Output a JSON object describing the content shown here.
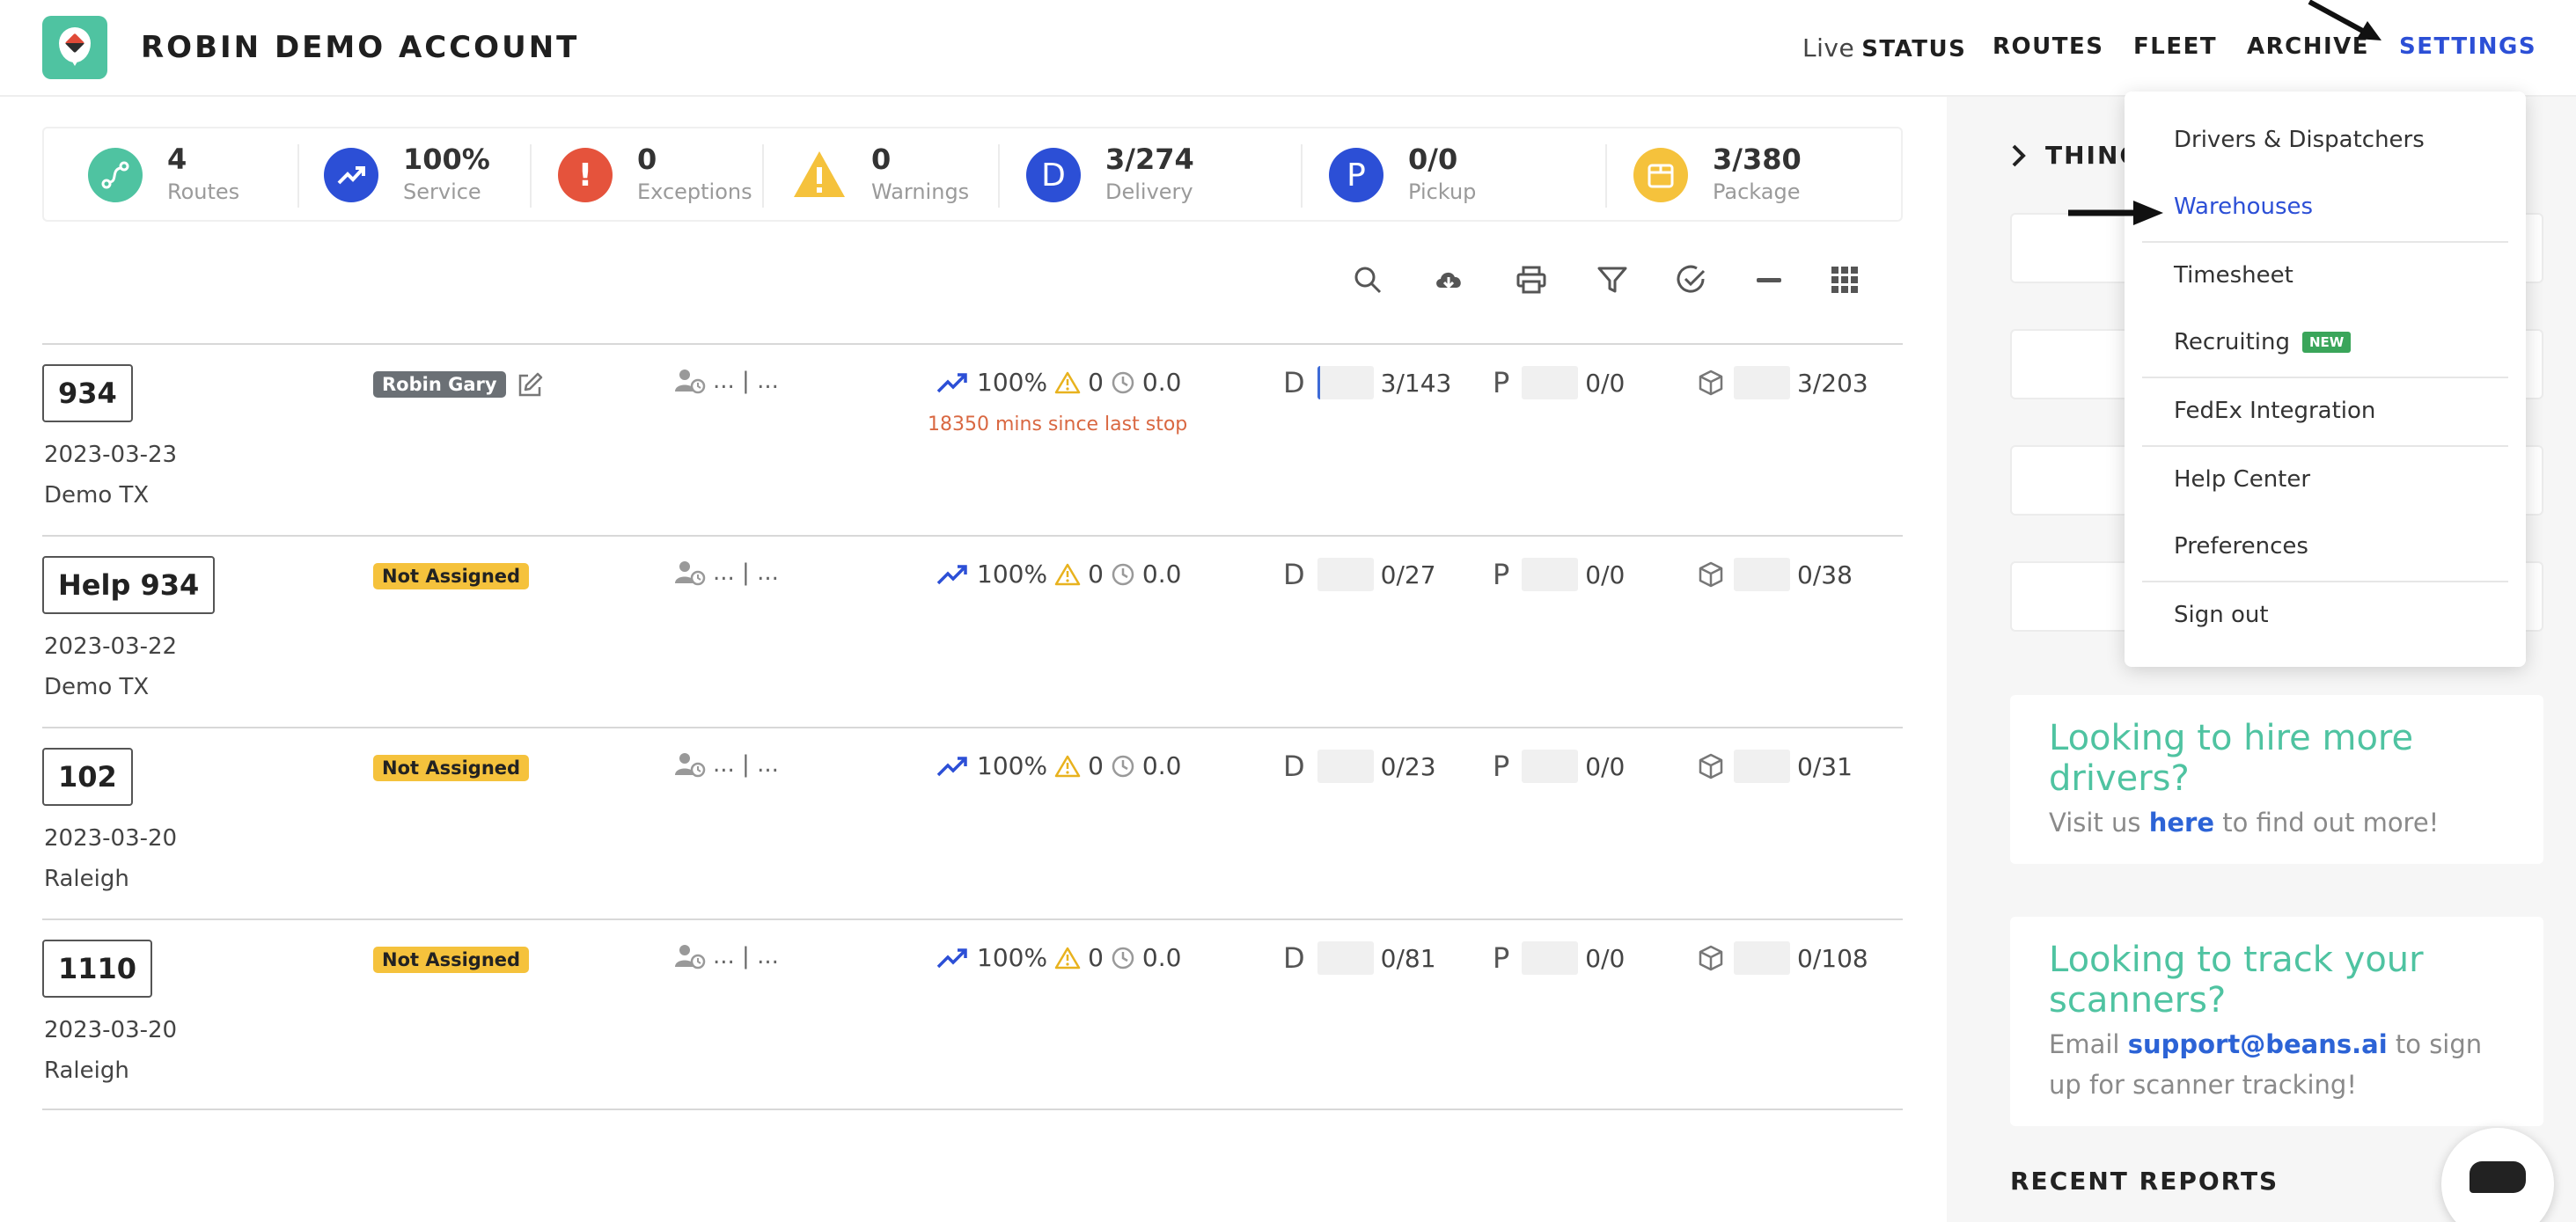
{
  "header": {
    "account_name": "ROBIN DEMO ACCOUNT",
    "nav": {
      "live_prefix": "Live",
      "live_status": "STATUS",
      "routes": "ROUTES",
      "fleet": "FLEET",
      "archive": "ARCHIVE",
      "settings": "SETTINGS"
    }
  },
  "stats": [
    {
      "value": "4",
      "label": "Routes",
      "icon": "route-icon",
      "color": "#4fc3a1"
    },
    {
      "value": "100%",
      "label": "Service",
      "icon": "trend-up-icon",
      "color": "#2c4fd6"
    },
    {
      "value": "0",
      "label": "Exceptions",
      "icon": "exclamation-circle-icon",
      "color": "#e5533c"
    },
    {
      "value": "0",
      "label": "Warnings",
      "icon": "warning-triangle-icon",
      "color": "#f5c23c"
    },
    {
      "value": "3/274",
      "label": "Delivery",
      "icon_letter": "D",
      "color": "#2c4fd6"
    },
    {
      "value": "0/0",
      "label": "Pickup",
      "icon_letter": "P",
      "color": "#2c4fd6"
    },
    {
      "value": "3/380",
      "label": "Package",
      "icon": "package-icon",
      "color": "#f5c23c"
    }
  ],
  "toolbar": [
    "search-icon",
    "cloud-download-icon",
    "print-icon",
    "filter-icon",
    "check-circle-icon",
    "collapse-icon",
    "grid-icon"
  ],
  "routes": [
    {
      "id": "934",
      "date": "2023-03-23",
      "city": "Demo TX",
      "driver": "Robin Gary",
      "assigned": true,
      "assign_text": "... | ...",
      "service": "100%",
      "warnings": "0",
      "time": "0.0",
      "since_last_stop": "18350 mins since last stop",
      "delivery": "3/143",
      "pickup": "0/0",
      "package": "3/203"
    },
    {
      "id": "Help 934",
      "date": "2023-03-22",
      "city": "Demo TX",
      "driver": "Not Assigned",
      "assigned": false,
      "assign_text": "... | ...",
      "service": "100%",
      "warnings": "0",
      "time": "0.0",
      "since_last_stop": "",
      "delivery": "0/27",
      "pickup": "0/0",
      "package": "0/38"
    },
    {
      "id": "102",
      "date": "2023-03-20",
      "city": "Raleigh",
      "driver": "Not Assigned",
      "assigned": false,
      "assign_text": "... | ...",
      "service": "100%",
      "warnings": "0",
      "time": "0.0",
      "since_last_stop": "",
      "delivery": "0/23",
      "pickup": "0/0",
      "package": "0/31"
    },
    {
      "id": "1110",
      "date": "2023-03-20",
      "city": "Raleigh",
      "driver": "Not Assigned",
      "assigned": false,
      "assign_text": "... | ...",
      "service": "100%",
      "warnings": "0",
      "time": "0.0",
      "since_last_stop": "",
      "delivery": "0/81",
      "pickup": "0/0",
      "package": "0/108"
    }
  ],
  "letters": {
    "delivery": "D",
    "pickup": "P"
  },
  "right_panel": {
    "things_title": "THING",
    "promo_hire": {
      "title": "Looking to hire more drivers?",
      "text_before": "Visit us",
      "link": "here",
      "text_after": "to find out more!"
    },
    "promo_track": {
      "title": "Looking to track your scanners?",
      "text_before": "Email",
      "link": "support@beans.ai",
      "text_after": "to sign up for scanner tracking!"
    },
    "recent_reports": "RECENT REPORTS"
  },
  "settings_menu": {
    "items": [
      "Drivers & Dispatchers",
      "Warehouses",
      "Timesheet",
      "Recruiting",
      "FedEx Integration",
      "Help Center",
      "Preferences",
      "Sign out"
    ],
    "new_tag": "NEW",
    "highlighted": "Warehouses"
  }
}
